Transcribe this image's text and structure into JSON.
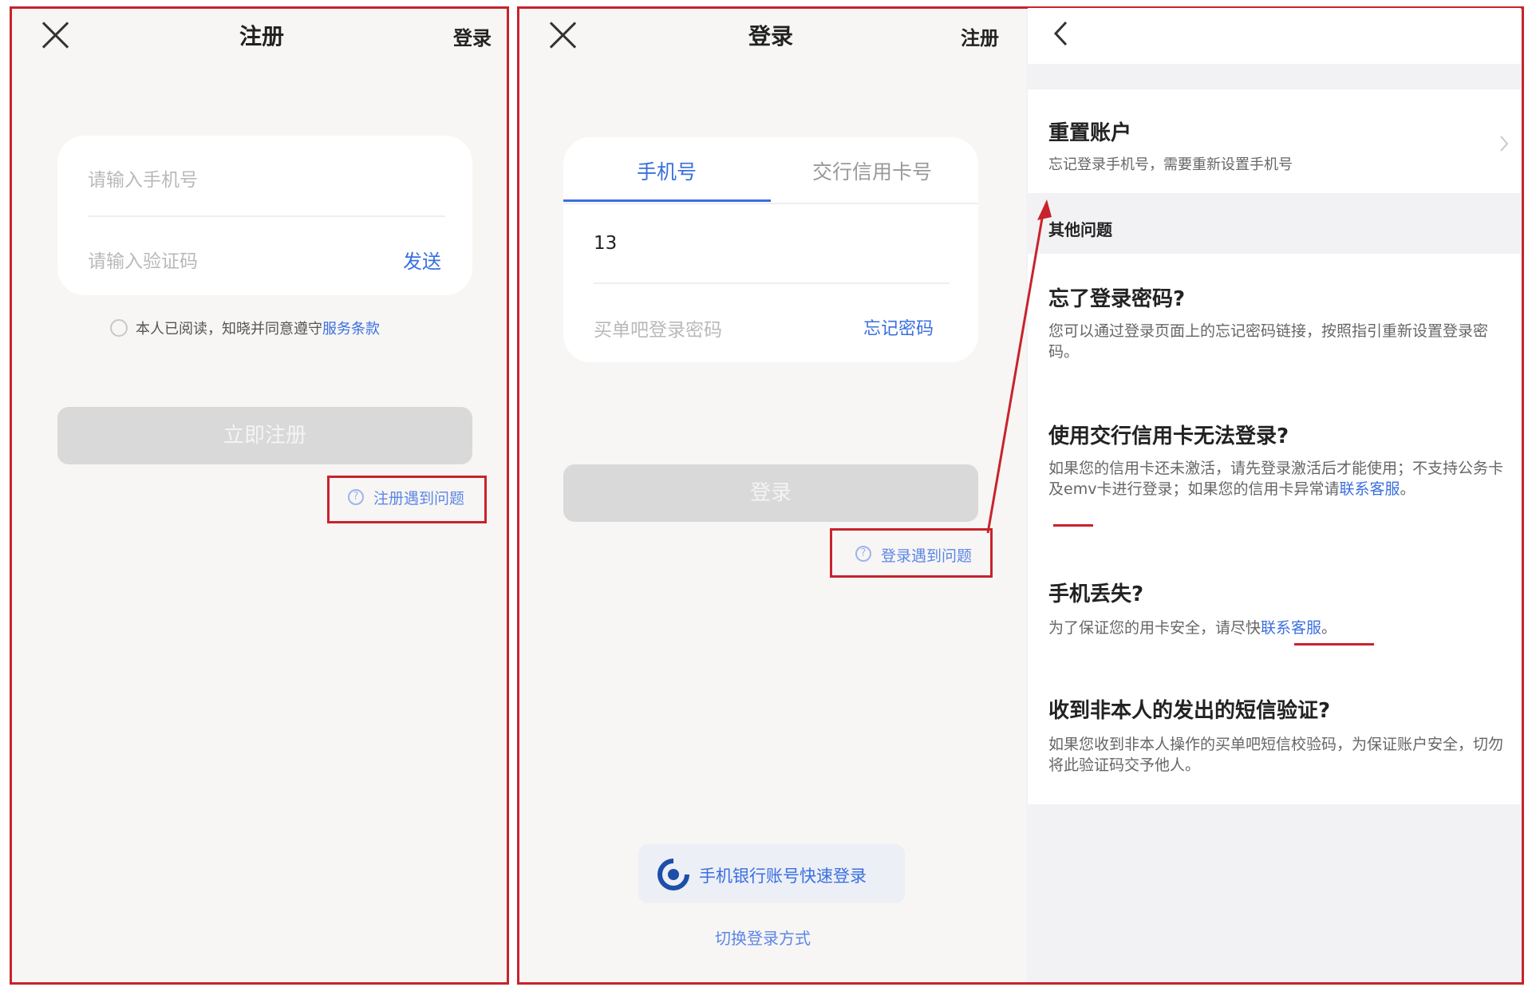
{
  "register": {
    "title": "注册",
    "login_link": "登录",
    "phone_placeholder": "请输入手机号",
    "code_placeholder": "请输入验证码",
    "send_label": "发送",
    "agreement_text": "本人已阅读，知晓并同意遵守",
    "agreement_link": "服务条款",
    "submit_label": "立即注册",
    "help_label": "注册遇到问题"
  },
  "login": {
    "title": "登录",
    "register_link": "注册",
    "tabs": [
      "手机号",
      "交行信用卡号"
    ],
    "phone_value": "13",
    "password_placeholder": "买单吧登录密码",
    "forgot_label": "忘记密码",
    "submit_label": "登录",
    "help_label": "登录遇到问题",
    "quick_login_label": "手机银行账号快速登录",
    "switch_label": "切换登录方式"
  },
  "help": {
    "reset_title": "重置账户",
    "reset_sub": "忘记登录手机号，需要重新设置手机号",
    "section_title": "其他问题",
    "faq": [
      {
        "q": "忘了登录密码?",
        "a": "您可以通过登录页面上的忘记密码链接，按照指引重新设置登录密码。",
        "link": ""
      },
      {
        "q": "使用交行信用卡无法登录?",
        "a": "如果您的信用卡还未激活，请先登录激活后才能使用；不支持公务卡及emv卡进行登录；如果您的信用卡异常请",
        "link": "联系客服",
        "tail": "。"
      },
      {
        "q": "手机丢失?",
        "a": "为了保证您的用卡安全，请尽快",
        "link": "联系客服",
        "tail": "。"
      },
      {
        "q": "收到非本人的发出的短信验证?",
        "a": "如果您收到非本人操作的买单吧短信校验码，为保证账户安全，切勿将此验证码交予他人。",
        "link": ""
      }
    ]
  },
  "colors": {
    "accent": "#3a6fe0",
    "annotation": "#c8232c",
    "disabled": "#d9d9d9"
  }
}
